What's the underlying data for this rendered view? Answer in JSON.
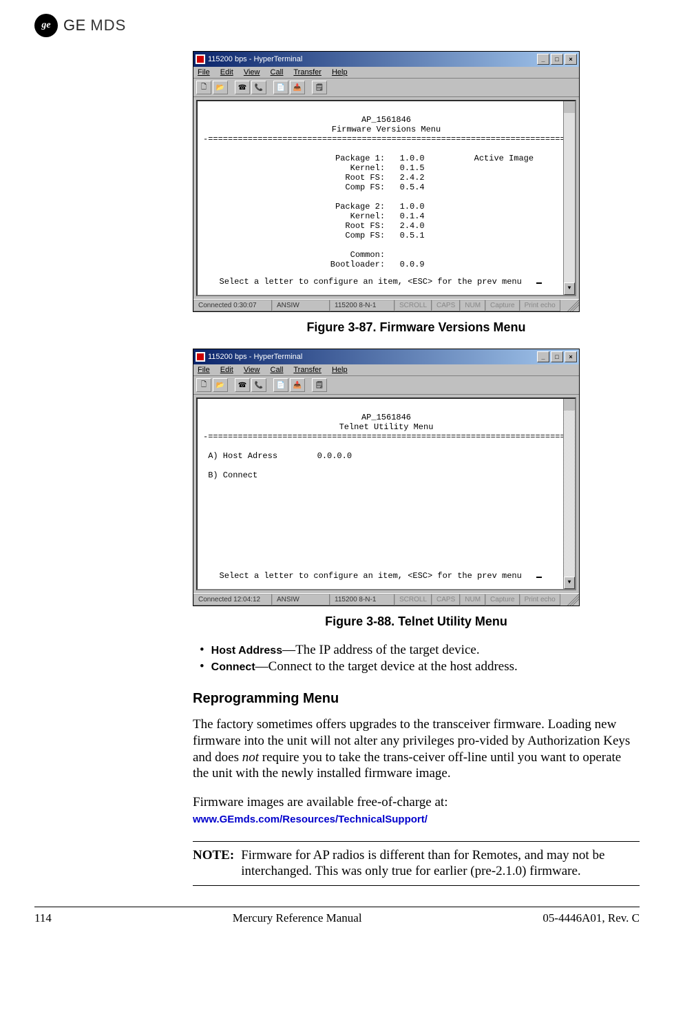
{
  "header": {
    "brand_ge": "GE",
    "brand_mds": "MDS"
  },
  "screenshot1": {
    "title": "115200 bps - HyperTerminal",
    "menus": [
      "File",
      "Edit",
      "View",
      "Call",
      "Transfer",
      "Help"
    ],
    "terminal_header": "AP_1561846",
    "terminal_subheader": "Firmware Versions Menu",
    "divider": "-==========================================================================-",
    "lines_block1": [
      "          Package 1:   1.0.0          Active Image",
      "             Kernel:   0.1.5",
      "            Root FS:   2.4.2",
      "            Comp FS:   0.5.4"
    ],
    "lines_block2": [
      "          Package 2:   1.0.0",
      "             Kernel:   0.1.4",
      "            Root FS:   2.4.0",
      "            Comp FS:   0.5.1"
    ],
    "lines_block3": [
      "             Common:",
      "         Bootloader:   0.0.9"
    ],
    "prompt": "Select a letter to configure an item, <ESC> for the prev menu",
    "status": {
      "conn": "Connected 0:30:07",
      "emul": "ANSIW",
      "port": "115200 8-N-1",
      "s1": "SCROLL",
      "s2": "CAPS",
      "s3": "NUM",
      "s4": "Capture",
      "s5": "Print echo"
    }
  },
  "caption1": "Figure 3-87. Firmware Versions Menu",
  "screenshot2": {
    "title": "115200 bps - HyperTerminal",
    "menus": [
      "File",
      "Edit",
      "View",
      "Call",
      "Transfer",
      "Help"
    ],
    "terminal_header": "AP_1561846",
    "terminal_subheader": "Telnet Utility Menu",
    "divider": "-==========================================================================-",
    "lines": [
      " A) Host Adress        0.0.0.0",
      "",
      " B) Connect"
    ],
    "prompt": "Select a letter to configure an item, <ESC> for the prev menu",
    "status": {
      "conn": "Connected 12:04:12",
      "emul": "ANSIW",
      "port": "115200 8-N-1",
      "s1": "SCROLL",
      "s2": "CAPS",
      "s3": "NUM",
      "s4": "Capture",
      "s5": "Print echo"
    }
  },
  "caption2": "Figure 3-88. Telnet Utility Menu",
  "bullets": {
    "b1_label": "Host Address",
    "b1_text": "—The IP address of the target device.",
    "b2_label": "Connect",
    "b2_text": "—Connect to the target device at the host address."
  },
  "section_heading": "Reprogramming Menu",
  "para1_a": "The factory sometimes offers upgrades to the transceiver firmware. Loading new firmware into the unit will not alter any privileges pro-vided by Authorization Keys and does ",
  "para1_not": "not",
  "para1_b": " require you to take the trans-ceiver off-line until you want to operate the unit with the newly installed firmware image.",
  "para2": "Firmware images are available free-of-charge at:",
  "link": "www.GEmds.com/Resources/TechnicalSupport/",
  "note_label": "NOTE:",
  "note_a": "Firmware for AP radios is different than for Remotes, and may ",
  "note_not": "not",
  "note_b": " be interchanged. This was only true for earlier (pre-2.1.0) firmware.",
  "footer": {
    "left": "114",
    "center": "Mercury Reference Manual",
    "right": "05-4446A01, Rev. C"
  }
}
